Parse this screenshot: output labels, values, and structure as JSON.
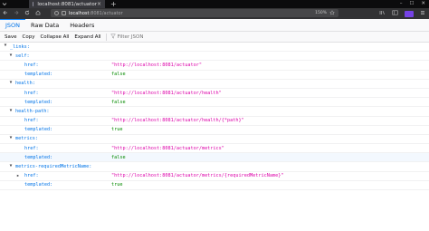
{
  "browser": {
    "tab_title": "localhost:8081/actuator",
    "url_host": "localhost",
    "url_rest": ":8081/actuator",
    "zoom": "150%",
    "tab_close": "×",
    "newtab": "+",
    "win_min": "–",
    "win_max": "☐",
    "win_close": "✕",
    "icons": [
      "back-icon",
      "forward-icon",
      "reload-icon",
      "home-icon",
      "star-icon",
      "library-icon",
      "sidebar-icon",
      "menu-icon"
    ]
  },
  "viewer": {
    "tabs": [
      "JSON",
      "Raw Data",
      "Headers"
    ],
    "toolbar": [
      "Save",
      "Copy",
      "Collapse All",
      "Expand All"
    ],
    "filter_placeholder": "Filter JSON"
  },
  "tree": {
    "rows": [
      {
        "key": "_links:"
      },
      {
        "key": "self:"
      },
      {
        "key": "href:",
        "value": "\"http://localhost:8081/actuator\"",
        "type": "string"
      },
      {
        "key": "templated:",
        "value": "false",
        "type": "bool"
      },
      {
        "key": "health:"
      },
      {
        "key": "href:",
        "value": "\"http://localhost:8081/actuator/health\"",
        "type": "string"
      },
      {
        "key": "templated:",
        "value": "false",
        "type": "bool"
      },
      {
        "key": "health-path:"
      },
      {
        "key": "href:",
        "value": "\"http://localhost:8081/actuator/health/{*path}\"",
        "type": "string"
      },
      {
        "key": "templated:",
        "value": "true",
        "type": "bool"
      },
      {
        "key": "metrics:"
      },
      {
        "key": "href:",
        "value": "\"http://localhost:8081/actuator/metrics\"",
        "type": "string"
      },
      {
        "key": "templated:",
        "value": "false",
        "type": "bool"
      },
      {
        "key": "metrics-requiredMetricName:"
      },
      {
        "key": "href:",
        "value": "\"http://localhost:8081/actuator/metrics/{requiredMetricName}\"",
        "type": "string"
      },
      {
        "key": "templated:",
        "value": "true",
        "type": "bool"
      }
    ]
  },
  "colors": {
    "key": "#0074e8",
    "string": "#dd00a9",
    "bool": "#058b00",
    "active_tab": "#0074e8"
  }
}
